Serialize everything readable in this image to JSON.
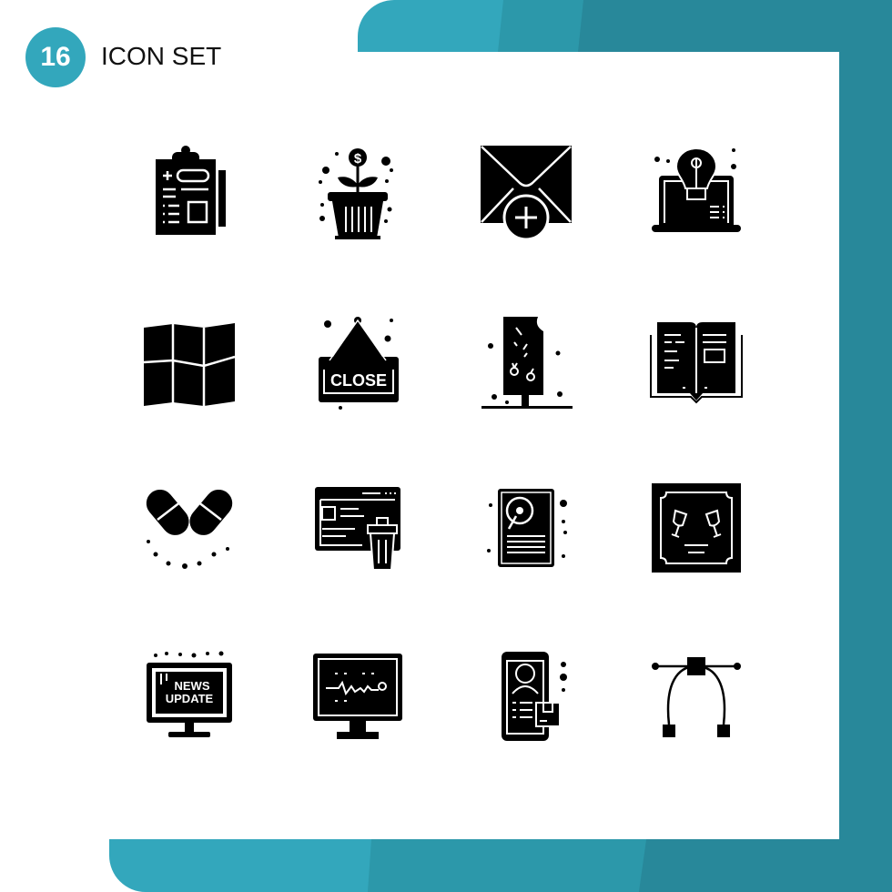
{
  "header": {
    "badge_number": "16",
    "title": "ICON SET"
  },
  "colors": {
    "accent_light": "#33a7bc",
    "accent_mid": "#2c98aa",
    "accent_dark": "#28889a",
    "icon": "#000000",
    "background": "#ffffff"
  },
  "icons": [
    {
      "name": "medical-report-clipboard-icon"
    },
    {
      "name": "money-plant-pot-icon"
    },
    {
      "name": "add-mail-envelope-icon"
    },
    {
      "name": "laptop-lightbulb-idea-icon"
    },
    {
      "name": "folded-map-icon"
    },
    {
      "name": "close-sign-icon",
      "text": "CLOSE"
    },
    {
      "name": "ice-cream-bar-icon"
    },
    {
      "name": "open-book-icon"
    },
    {
      "name": "pills-capsules-icon"
    },
    {
      "name": "web-page-delete-trash-icon"
    },
    {
      "name": "hard-disk-drive-icon"
    },
    {
      "name": "wine-glasses-frame-icon"
    },
    {
      "name": "news-update-monitor-icon",
      "text_line1": "NEWS",
      "text_line2": "UPDATE"
    },
    {
      "name": "monitor-graph-icon"
    },
    {
      "name": "mobile-profile-package-icon"
    },
    {
      "name": "bezier-curve-pen-icon"
    }
  ]
}
